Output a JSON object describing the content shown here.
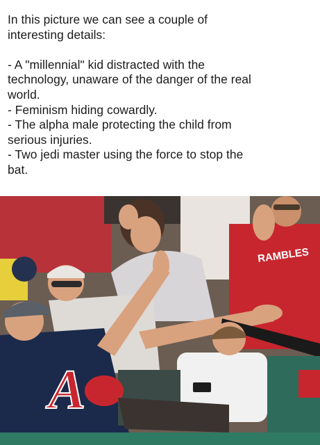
{
  "caption": {
    "intro": [
      "In this picture we can see a couple of",
      "interesting details:"
    ],
    "details": [
      "- A \"millennial\" kid distracted with the",
      "technology, unaware of the danger of the real",
      "world.",
      "- Feminism hiding cowardly.",
      "- The alpha male protecting the child from",
      "serious injuries.",
      "- Two jedi master using the force to stop the",
      "bat."
    ]
  },
  "photo": {
    "jersey_text_right": "RAMBLES",
    "jersey_text_left": "A",
    "colors": {
      "braves_red": "#c8262e",
      "navy": "#1b2a4a",
      "bat": "#1a1a1a",
      "stadium_green": "#2e6b5a",
      "skin": "#d9a27e"
    }
  }
}
